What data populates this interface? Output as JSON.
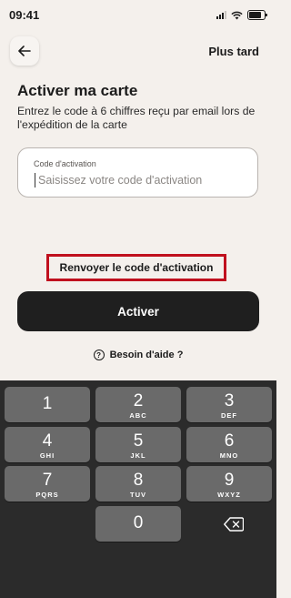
{
  "status_bar": {
    "time": "09:41"
  },
  "header": {
    "later_label": "Plus tard"
  },
  "main": {
    "title": "Activer ma carte",
    "subtitle": "Entrez le code à 6 chiffres reçu par email lors de l'expédition de la carte",
    "field": {
      "label": "Code d'activation",
      "placeholder": "Saisissez votre code d'activation",
      "value": ""
    },
    "resend_label": "Renvoyer le code d'activation",
    "activate_label": "Activer",
    "help_label": "Besoin d'aide ?"
  },
  "keyboard": {
    "keys": [
      {
        "num": "1",
        "letters": ""
      },
      {
        "num": "2",
        "letters": "ABC"
      },
      {
        "num": "3",
        "letters": "DEF"
      },
      {
        "num": "4",
        "letters": "GHI"
      },
      {
        "num": "5",
        "letters": "JKL"
      },
      {
        "num": "6",
        "letters": "MNO"
      },
      {
        "num": "7",
        "letters": "PQRS"
      },
      {
        "num": "8",
        "letters": "TUV"
      },
      {
        "num": "9",
        "letters": "WXYZ"
      },
      {
        "num": "0",
        "letters": ""
      }
    ]
  },
  "colors": {
    "background": "#f4f0ec",
    "button_dark": "#1f1f1f",
    "highlight_border": "#c0101e",
    "keyboard_bg": "#2b2b2b",
    "key_bg": "#6a6a6a"
  }
}
